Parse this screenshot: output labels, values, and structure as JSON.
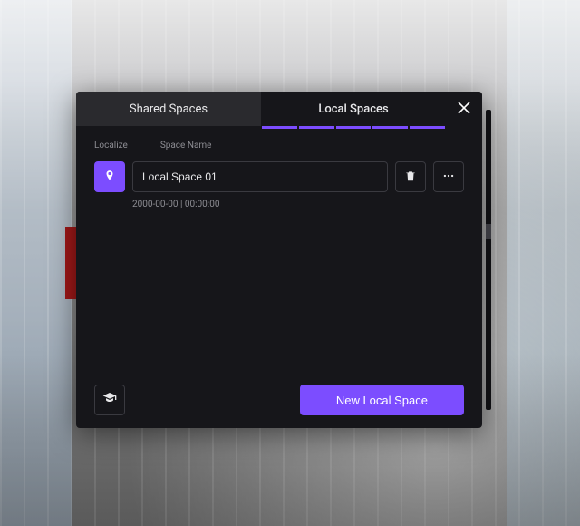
{
  "tabs": {
    "shared": "Shared Spaces",
    "local": "Local Spaces",
    "active": "local"
  },
  "columns": {
    "localize": "Localize",
    "spaceName": "Space Name"
  },
  "spaces": [
    {
      "name": "Local Space 01",
      "timestamp": "2000-00-00 | 00:00:00"
    }
  ],
  "buttons": {
    "newLocalSpace": "New Local Space"
  },
  "colors": {
    "accent": "#7c4dff",
    "panel": "#16161a",
    "border": "#3a3a40"
  },
  "icons": {
    "close": "close-icon",
    "pin": "pin-icon",
    "trash": "trash-icon",
    "more": "more-icon",
    "grad": "graduation-cap-icon"
  }
}
